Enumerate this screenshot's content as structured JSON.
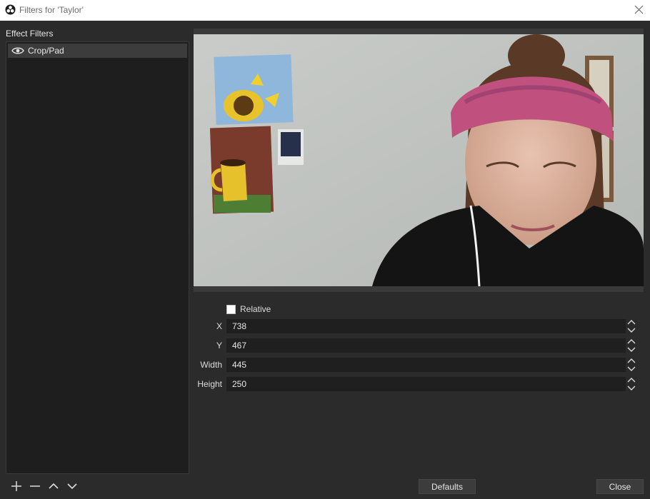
{
  "window": {
    "title": "Filters for 'Taylor'"
  },
  "filters": {
    "heading": "Effect Filters",
    "items": [
      {
        "label": "Crop/Pad",
        "visible_icon": "eye-icon"
      }
    ]
  },
  "list_tools": [
    "add-icon",
    "remove-icon",
    "move-up-icon",
    "move-down-icon"
  ],
  "properties": {
    "relative_label": "Relative",
    "relative_checked": false,
    "fields": [
      {
        "label": "X",
        "value": "738"
      },
      {
        "label": "Y",
        "value": "467"
      },
      {
        "label": "Width",
        "value": "445"
      },
      {
        "label": "Height",
        "value": "250"
      }
    ]
  },
  "buttons": {
    "defaults": "Defaults",
    "close": "Close"
  },
  "colors": {
    "background": "#2b2b2b",
    "list_bg": "#1e1e1e",
    "field_bg": "#1f1f1f",
    "selected_item": "#3c3c3c"
  }
}
